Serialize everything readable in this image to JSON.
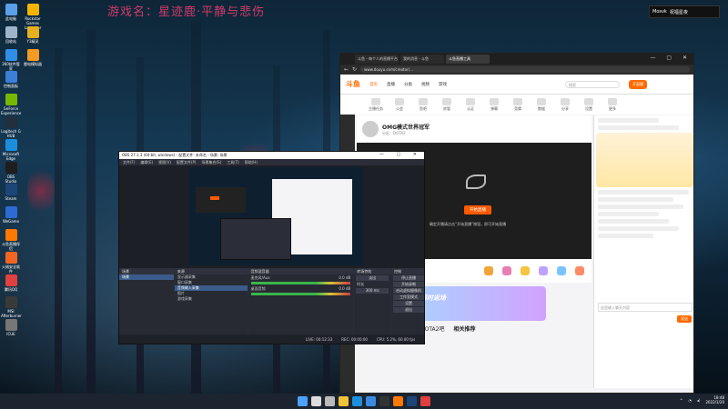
{
  "overlay_text": "游戏名：星迹鹿·平静与悲伤",
  "desktop_icons_col1": [
    {
      "label": "此电脑",
      "icon": "computer-icon",
      "color": "#5aa0e8"
    },
    {
      "label": "回收站",
      "icon": "recycle-bin-icon",
      "color": "#9db4c9"
    },
    {
      "label": "360软件管家",
      "icon": "app-store-icon",
      "color": "#2f8fe6"
    },
    {
      "label": "控制面板",
      "icon": "control-panel-icon",
      "color": "#3c7fd6"
    },
    {
      "label": "GeForce Experience",
      "icon": "geforce-icon",
      "color": "#76b900"
    },
    {
      "label": "Logitech G HUB",
      "icon": "ghub-icon",
      "color": "#222f3e"
    },
    {
      "label": "Microsoft Edge",
      "icon": "edge-icon",
      "color": "#1c8fdc"
    },
    {
      "label": "OBS Studio",
      "icon": "obs-icon",
      "color": "#1e1e1e"
    },
    {
      "label": "Steam",
      "icon": "steam-icon",
      "color": "#1b4677"
    },
    {
      "label": "WeGame",
      "icon": "wegame-icon",
      "color": "#2c6bd1"
    },
    {
      "label": "斗鱼直播伴侣",
      "icon": "douyu-icon",
      "color": "#ff7800"
    },
    {
      "label": "火绒安全软件",
      "icon": "huorong-icon",
      "color": "#f26522"
    },
    {
      "label": "腾讯QQ",
      "icon": "qq-icon",
      "color": "#e04040"
    },
    {
      "label": "MSI Afterburner",
      "icon": "afterburner-icon",
      "color": "#3a3a3a"
    },
    {
      "label": "ICUE",
      "icon": "icue-icon",
      "color": "#777777"
    }
  ],
  "desktop_icons_col2": [
    {
      "label": "Rockstar Games Launcher",
      "icon": "rockstar-icon",
      "color": "#f4b400"
    },
    {
      "label": "Y3精灵",
      "icon": "assistant-icon",
      "color": "#e6b020"
    },
    {
      "label": "雷电模拟器",
      "icon": "emulator-icon",
      "color": "#f59a23"
    }
  ],
  "notification": {
    "name": "Mosvk",
    "message": "祝福星夜"
  },
  "browser": {
    "tabs": [
      "斗鱼 - 每个人的直播平台",
      "我的消息 - 斗鱼",
      "斗鱼直播工具"
    ],
    "url": "www.douyu.com/creator/...",
    "logo": "斗鱼",
    "nav_links": [
      "首页",
      "直播",
      "分类",
      "视频",
      "游戏"
    ],
    "search_placeholder": "搜索",
    "upload_label": "开直播",
    "categories": [
      "主播任务",
      "公会",
      "鱼吧",
      "房管",
      "认证",
      "弹幕",
      "竞猜",
      "数据",
      "分享",
      "设置",
      "更多"
    ],
    "stream_title": "OMG模式世界冠军",
    "stream_sub": "分区：DOTA2",
    "video_button": "开始直播",
    "video_message": "确定开播请点击“开始直播”按钮，即可开始直播",
    "banner_text": "礼物限时返场",
    "rec_links": [
      "DOTA2吧",
      "相关推荐"
    ],
    "chat_placeholder": "这里输入聊天内容",
    "send_label": "发送"
  },
  "obs": {
    "title": "OBS 27.1.3 (64-bit, windows) - 配置文件: 未命名 - 场景: 场景",
    "menu": [
      "文件(F)",
      "编辑(E)",
      "视图(V)",
      "配置文件(P)",
      "场景集合(S)",
      "工具(T)",
      "帮助(H)"
    ],
    "panels": {
      "scenes_head": "场景",
      "scenes": [
        "场景"
      ],
      "sources_head": "来源",
      "sources": [
        "显示器采集",
        "窗口采集",
        "音频输入采集",
        "图片",
        "游戏采集"
      ],
      "mixer_head": "音频混音器",
      "mixer": [
        {
          "name": "麦克风/Aux",
          "level": "0.0 dB"
        },
        {
          "name": "桌面音频",
          "level": "0.0 dB"
        }
      ],
      "transitions_head": "转场特效",
      "transition_value": "淡出",
      "duration_label": "时长",
      "duration_value": "300 ms",
      "controls_head": "控制",
      "controls": [
        "停止直播",
        "开始录制",
        "启动虚拟摄像机",
        "工作室模式",
        "设置",
        "退出"
      ]
    },
    "status": [
      "LIVE: 00:12:33",
      "REC: 00:00:00",
      "CPU: 5.2%, 60.00 fps"
    ]
  },
  "taskbar": {
    "icons": [
      {
        "name": "start-icon",
        "color": "#4aa3ff"
      },
      {
        "name": "search-icon",
        "color": "#dddddd"
      },
      {
        "name": "task-view-icon",
        "color": "#bbbbbb"
      },
      {
        "name": "explorer-icon",
        "color": "#f2c23a"
      },
      {
        "name": "edge-icon",
        "color": "#1c8fdc"
      },
      {
        "name": "store-icon",
        "color": "#3a8be0"
      },
      {
        "name": "obs-icon",
        "color": "#333333"
      },
      {
        "name": "douyu-icon",
        "color": "#ff7800"
      },
      {
        "name": "steam-icon",
        "color": "#1b4677"
      },
      {
        "name": "qq-icon",
        "color": "#e04040"
      }
    ],
    "time": "18:48",
    "date": "2022/1/20"
  }
}
